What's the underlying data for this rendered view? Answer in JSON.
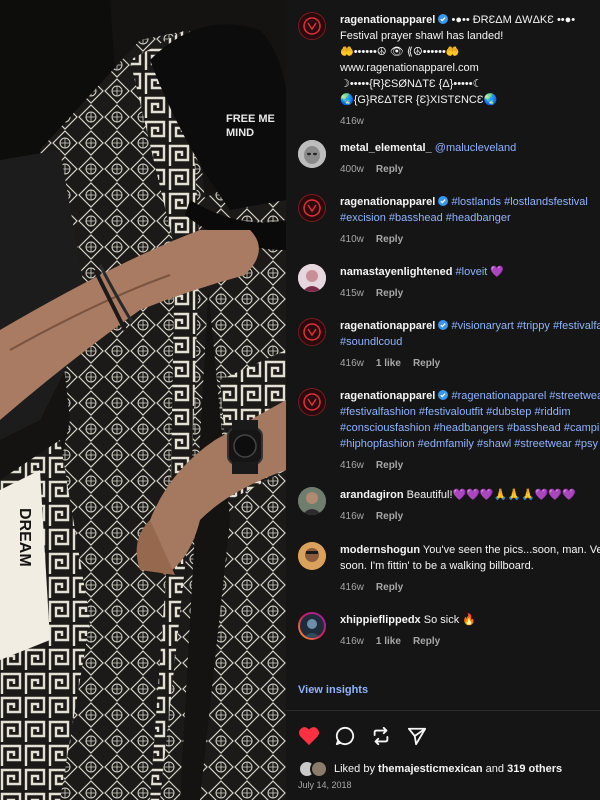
{
  "post": {
    "author": "ragenationapparel",
    "caption_lines": [
      "•●•• ĐRƐΔM ΔWΔKƐ ••●•",
      "Festival prayer shawl has landed!",
      "🤲••••••☮ 👁 ⟪☮••••••🤲",
      "www.ragenationapparel.com",
      "☽•••••{R}ƐSØNΔTƐ {Δ}•••••☾",
      "🌏{G}RƐΔTƐR {Ɛ}XISTƐNCƐ🌏"
    ],
    "age": "416w"
  },
  "comments": [
    {
      "user": "metal_elemental_",
      "tags": "@malucleveland",
      "text": "",
      "age": "400w",
      "likes": "",
      "reply": "Reply"
    },
    {
      "user": "ragenationapparel",
      "tags": "#lostlands #lostlandsfestival #excision #basshead #headbanger",
      "text": "",
      "age": "410w",
      "likes": "",
      "reply": "Reply"
    },
    {
      "user": "namastayenlightened",
      "tags": "#loveit",
      "text": "💜",
      "age": "415w",
      "likes": "",
      "reply": "Reply"
    },
    {
      "user": "ragenationapparel",
      "tags": "#visionaryart #trippy #festivalfashion #soundlcoud",
      "text": "",
      "age": "416w",
      "likes": "1 like",
      "reply": "Reply"
    },
    {
      "user": "ragenationapparel",
      "tags": "#ragenationapparel #streetwear #festivalfashion #festivaloutfit #dubstep #riddim #consciousfashion #headbangers #basshead #camping #hiphopfashion #edmfamily #shawl #streetwear #psy",
      "text": "",
      "age": "416w",
      "likes": "",
      "reply": "Reply"
    },
    {
      "user": "arandagiron",
      "tags": "",
      "text": "Beautiful!💜💜💜🙏🙏🙏💜💜💜",
      "age": "416w",
      "likes": "",
      "reply": "Reply"
    },
    {
      "user": "modernshogun",
      "tags": "",
      "text": "You've seen the pics...soon, man. Very soon. I'm fittin' to be a walking billboard.",
      "age": "416w",
      "likes": "",
      "reply": "Reply"
    },
    {
      "user": "xhippieflippedx",
      "tags": "",
      "text": "So sick 🔥",
      "age": "416w",
      "likes": "1 like",
      "reply": "Reply"
    }
  ],
  "insights_label": "View insights",
  "likes": {
    "prefix": "Liked by",
    "user": "themajesticmexican",
    "joiner": "and",
    "others": "319 others"
  },
  "date": "July 14, 2018",
  "photo": {
    "cap_text_1": "FREE ME",
    "cap_text_2": "MIND",
    "shawl_text": "DREAM"
  },
  "icons": [
    "heart-icon",
    "comment-icon",
    "repost-icon",
    "share-icon",
    "verified-badge-icon"
  ],
  "colors": {
    "heart": "#ff3040",
    "link": "#8eb4ff",
    "verified": "#3897f0",
    "background": "#151515"
  }
}
